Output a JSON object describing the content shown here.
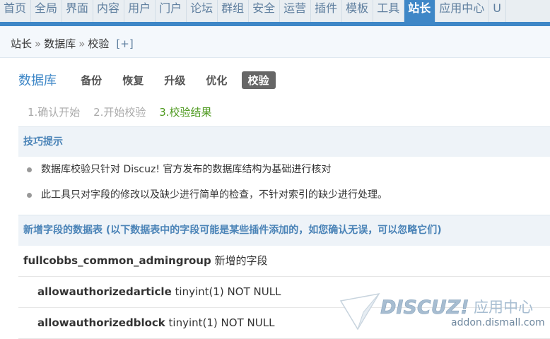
{
  "topnav": {
    "items": [
      "首页",
      "全局",
      "界面",
      "内容",
      "用户",
      "门户",
      "论坛",
      "群组",
      "安全",
      "运营",
      "插件",
      "模板",
      "工具",
      "站长",
      "应用中心",
      "U"
    ],
    "active_index": 13
  },
  "breadcrumb": {
    "parts": [
      "站长",
      "数据库",
      "校验"
    ],
    "separator": "»",
    "add_label": "[+]"
  },
  "subnav": {
    "title": "数据库",
    "tabs": [
      "备份",
      "恢复",
      "升级",
      "优化",
      "校验"
    ],
    "active_tab": "校验"
  },
  "steps": [
    "1.确认开始",
    "2.开始校验",
    "3.校验结果"
  ],
  "tips": {
    "heading": "技巧提示",
    "items": [
      "数据库校验只针对 Discuz! 官方发布的数据库结构为基础进行核对",
      "此工具只对字段的修改以及缺少进行简单的检查，不针对索引的缺少进行处理。"
    ]
  },
  "added_fields": {
    "heading": "新增字段的数据表 (以下数据表中的字段可能是某些插件添加的，如您确认无误，可以忽略它们)",
    "table_name": "fullcobbs_common_admingroup",
    "table_note": "新增的字段",
    "fields": [
      {
        "name": "allowauthorizedarticle",
        "type": "tinyint(1) NOT NULL"
      },
      {
        "name": "allowauthorizedblock",
        "type": "tinyint(1) NOT NULL"
      }
    ]
  },
  "watermark": {
    "brand": "DISCUZ!",
    "suffix": "应用中心",
    "url": "addon.dismall.com"
  },
  "colors": {
    "accent": "#3e87c7",
    "step_current": "#4f9a20",
    "active_tab_bg": "#666666"
  }
}
